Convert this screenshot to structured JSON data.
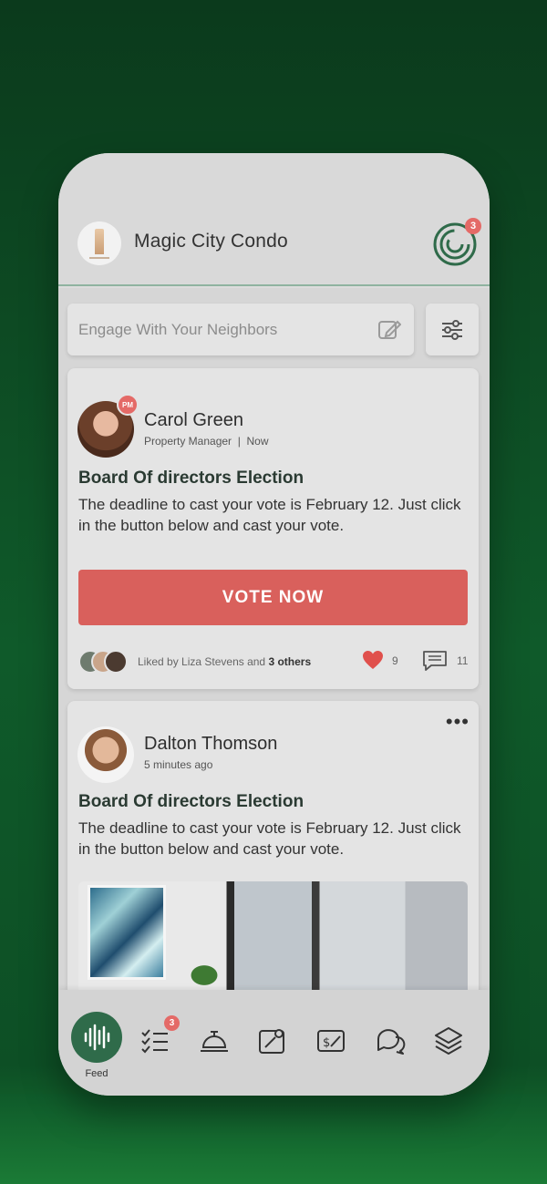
{
  "header": {
    "title": "Magic City Condo",
    "notification_count": "3"
  },
  "search": {
    "placeholder": "Engage With Your Neighbors"
  },
  "posts": [
    {
      "author": "Carol Green",
      "role_badge": "PM",
      "meta": "Property Manager  |  Now",
      "title": "Board Of directors Election",
      "body": "The deadline to cast your vote is February 12.  Just click in the button below and cast your vote.",
      "action_label": "VOTE NOW",
      "liked_by_prefix": "Liked by Liza Stevens and",
      "liked_by_others": "3 others",
      "like_count": "9",
      "comment_count": "11"
    },
    {
      "author": "Dalton Thomson",
      "meta": "5 minutes ago",
      "title": "Board Of directors Election",
      "body": "The deadline to cast your vote is February 12.  Just click in the button below and cast your vote."
    }
  ],
  "nav": {
    "feed_label": "Feed",
    "tasks_badge": "3"
  },
  "colors": {
    "accent": "#2f6b4a",
    "vote_button": "#d9605c",
    "badge": "#e46a67",
    "background": "#0f5a2a"
  },
  "icons": [
    "compose-icon",
    "filter-icon",
    "brand-notifications-icon",
    "heart-icon",
    "comment-icon",
    "more-icon",
    "feed-icon",
    "tasks-icon",
    "concierge-bell-icon",
    "edit-profile-icon",
    "payments-icon",
    "chat-icon",
    "layers-icon"
  ]
}
